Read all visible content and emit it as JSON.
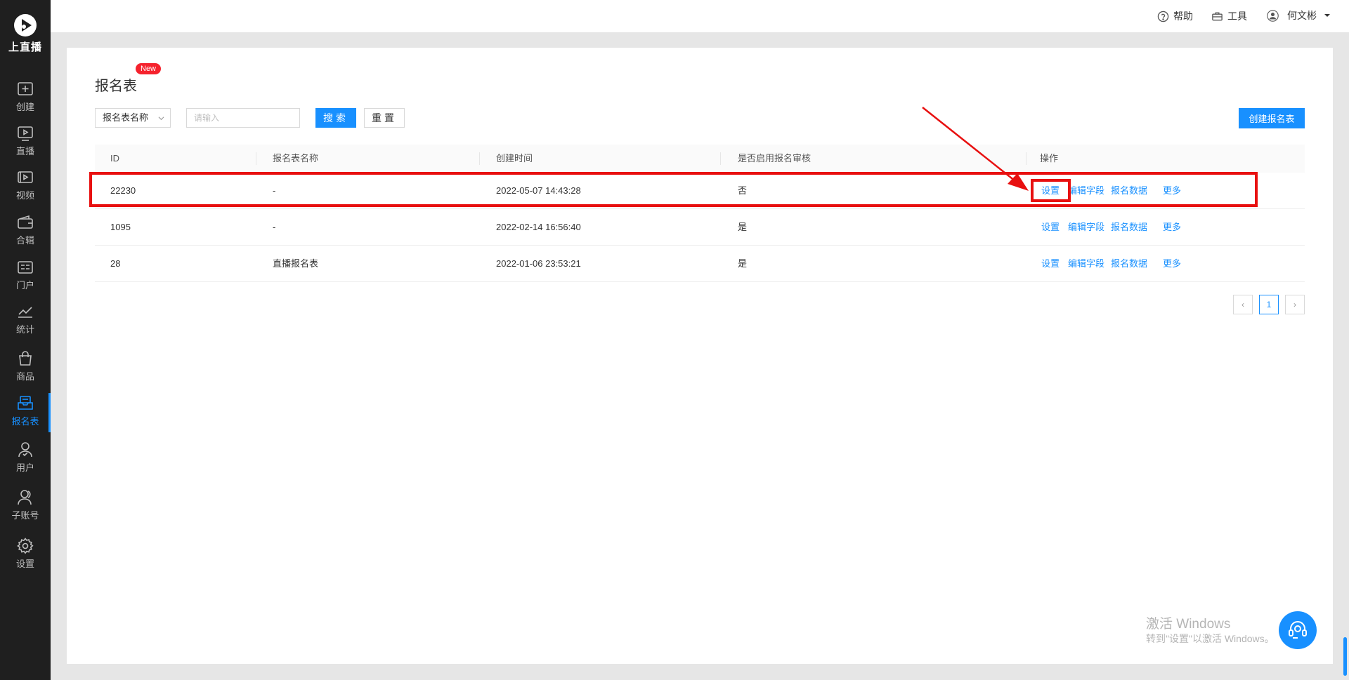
{
  "app": {
    "name": "上直播"
  },
  "sidebar": {
    "items": [
      {
        "label": "创建",
        "icon": "plus-square-icon"
      },
      {
        "label": "直播",
        "icon": "play-screen-icon"
      },
      {
        "label": "视频",
        "icon": "video-icon"
      },
      {
        "label": "合辑",
        "icon": "wallet-icon"
      },
      {
        "label": "门户",
        "icon": "portal-icon"
      },
      {
        "label": "统计",
        "icon": "chart-line-icon"
      },
      {
        "label": "商品",
        "icon": "shopping-bag-icon"
      },
      {
        "label": "报名表",
        "icon": "form-inbox-icon",
        "active": true
      },
      {
        "label": "用户",
        "icon": "user-check-icon"
      },
      {
        "label": "子账号",
        "icon": "users-icon"
      },
      {
        "label": "设置",
        "icon": "gear-icon"
      }
    ]
  },
  "topbar": {
    "help": "帮助",
    "tools": "工具",
    "user": "何文彬"
  },
  "page": {
    "title": "报名表",
    "badge": "New"
  },
  "filters": {
    "select_value": "报名表名称",
    "input_placeholder": "请输入",
    "search_label": "搜索",
    "reset_label": "重置",
    "create_label": "创建报名表"
  },
  "table": {
    "columns": [
      "ID",
      "报名表名称",
      "创建时间",
      "是否启用报名审核",
      "操作"
    ],
    "rows": [
      {
        "id": "22230",
        "name": "-",
        "created": "2022-05-07 14:43:28",
        "review": "否"
      },
      {
        "id": "1095",
        "name": "-",
        "created": "2022-02-14 16:56:40",
        "review": "是"
      },
      {
        "id": "28",
        "name": "直播报名表",
        "created": "2022-01-06 23:53:21",
        "review": "是"
      }
    ],
    "actions": [
      "设置",
      "编辑字段",
      "报名数据",
      "更多"
    ]
  },
  "pagination": {
    "current": "1",
    "prev": "‹",
    "next": "›"
  },
  "watermark": {
    "line1": "激活 Windows",
    "line2": "转到\"设置\"以激活 Windows。"
  },
  "colors": {
    "primary": "#1890ff",
    "sidebar": "#1f1f1f",
    "highlight": "#e81010",
    "badge": "#f5222d"
  }
}
